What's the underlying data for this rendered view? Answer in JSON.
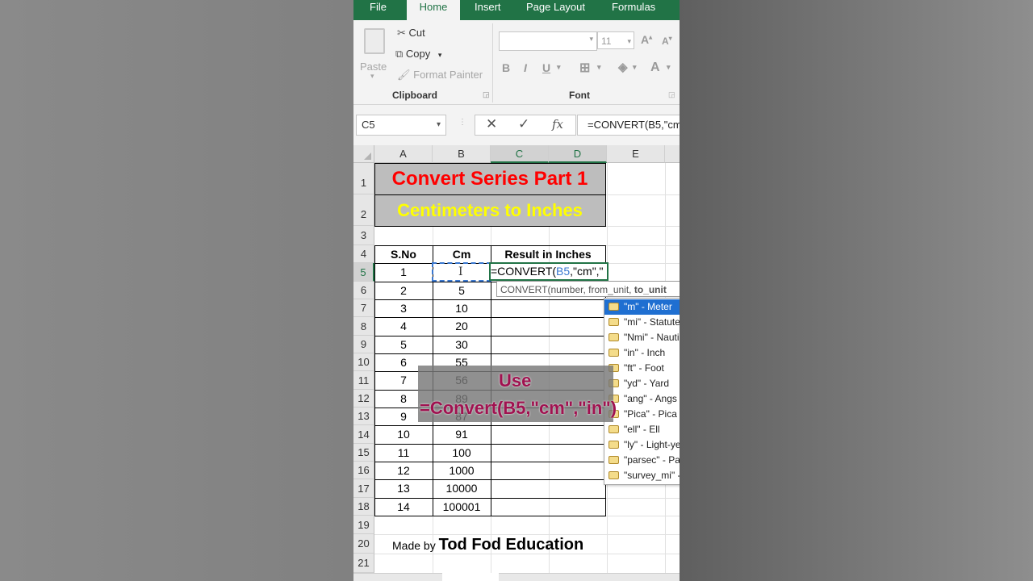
{
  "ribbon": {
    "tabs": [
      "File",
      "Home",
      "Insert",
      "Page Layout",
      "Formulas"
    ],
    "clipboard": {
      "paste_label": "Paste",
      "cut_label": "Cut",
      "copy_label": "Copy",
      "format_painter_label": "Format Painter",
      "group_label": "Clipboard"
    },
    "font": {
      "font_name_value": "",
      "font_size_value": "11",
      "bold_label": "B",
      "italic_label": "I",
      "underline_label": "U",
      "group_label": "Font"
    }
  },
  "formula_bar": {
    "name_box": "C5",
    "formula": "=CONVERT(B5,\"cm\""
  },
  "columns": [
    "A",
    "B",
    "C",
    "D",
    "E"
  ],
  "rows": [
    "1",
    "2",
    "3",
    "4",
    "5",
    "6",
    "7",
    "8",
    "9",
    "10",
    "11",
    "12",
    "13",
    "14",
    "15",
    "16",
    "17",
    "18",
    "19",
    "20",
    "21"
  ],
  "sheet": {
    "title": "Convert Series Part 1",
    "subtitle": "Centimeters to Inches",
    "headers": [
      "S.No",
      "Cm",
      "Result in Inches"
    ],
    "table": [
      [
        "1",
        ""
      ],
      [
        "2",
        "5"
      ],
      [
        "3",
        "10"
      ],
      [
        "4",
        "20"
      ],
      [
        "5",
        "30"
      ],
      [
        "6",
        "55"
      ],
      [
        "7",
        "56"
      ],
      [
        "8",
        "89"
      ],
      [
        "9",
        "87"
      ],
      [
        "10",
        "91"
      ],
      [
        "11",
        "100"
      ],
      [
        "12",
        "1000"
      ],
      [
        "13",
        "10000"
      ],
      [
        "14",
        "100001"
      ]
    ],
    "active_cell_formula_prefix": "=CONVERT(",
    "active_cell_ref": "B5",
    "active_cell_formula_suffix": ",\"cm\",\"",
    "tooltip_text": "CONVERT(number, from_unit, ",
    "tooltip_bold": "to_unit",
    "made_by_prefix": "Made by ",
    "made_by_name": "Tod Fod Education"
  },
  "autocomplete": [
    "\"m\" - Meter",
    "\"mi\" - Statute",
    "\"Nmi\" - Nauti",
    "\"in\" - Inch",
    "\"ft\" - Foot",
    "\"yd\" - Yard",
    "\"ang\" - Angs",
    "\"Pica\" - Pica",
    "\"ell\" - Ell",
    "\"ly\" - Light-ye",
    "\"parsec\" - Pa",
    "\"survey_mi\" -"
  ],
  "overlay": {
    "line1": "Use",
    "line2": "=Convert(B5,\"cm\",\"in\")"
  },
  "colors": {
    "excel_green": "#217346",
    "title_red": "#ff0000",
    "subtitle_yellow": "#ffff00",
    "overlay_text": "#a01250",
    "selection_blue": "#1f6fd1"
  }
}
